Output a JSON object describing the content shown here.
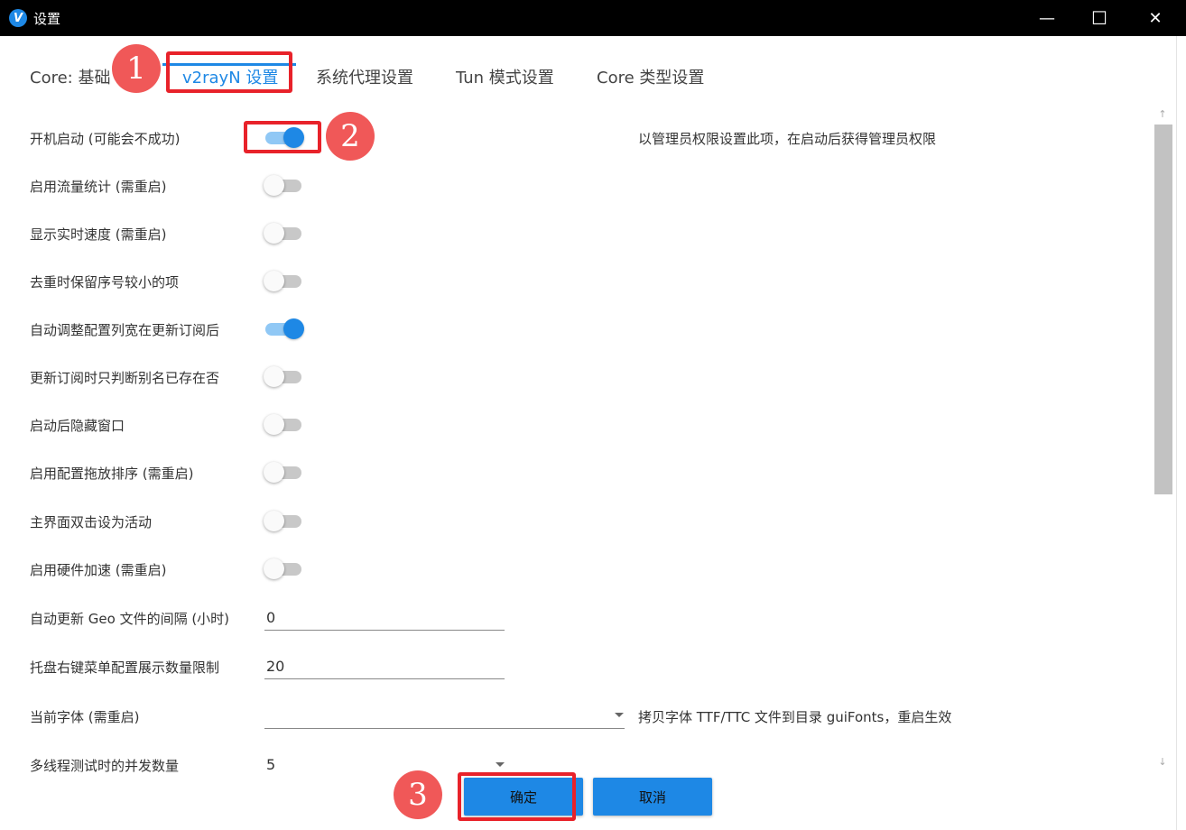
{
  "window": {
    "title": "设置",
    "icon_letter": "V",
    "controls": {
      "minimize": "—",
      "maximize": "☐",
      "close": "✕"
    }
  },
  "tabs": [
    {
      "label": "Core: 基础",
      "active": false
    },
    {
      "label": "v2rayN 设置",
      "active": true
    },
    {
      "label": "系统代理设置",
      "active": false
    },
    {
      "label": "Tun 模式设置",
      "active": false
    },
    {
      "label": "Core 类型设置",
      "active": false
    }
  ],
  "settings": {
    "toggles": [
      {
        "label": "开机启动 (可能会不成功)",
        "on": true
      },
      {
        "label": "启用流量统计 (需重启)",
        "on": false
      },
      {
        "label": "显示实时速度 (需重启)",
        "on": false
      },
      {
        "label": "去重时保留序号较小的项",
        "on": false
      },
      {
        "label": "自动调整配置列宽在更新订阅后",
        "on": true
      },
      {
        "label": "更新订阅时只判断别名已存在否",
        "on": false
      },
      {
        "label": "启动后隐藏窗口",
        "on": false
      },
      {
        "label": "启用配置拖放排序 (需重启)",
        "on": false
      },
      {
        "label": "主界面双击设为活动",
        "on": false
      },
      {
        "label": "启用硬件加速 (需重启)",
        "on": false
      }
    ],
    "autostart_hint": "以管理员权限设置此项，在启动后获得管理员权限",
    "geo_interval": {
      "label": "自动更新 Geo 文件的间隔 (小时)",
      "value": "0"
    },
    "tray_limit": {
      "label": "托盘右键菜单配置展示数量限制",
      "value": "20"
    },
    "font": {
      "label": "当前字体 (需重启)",
      "value": "",
      "hint": "拷贝字体 TTF/TTC 文件到目录 guiFonts，重启生效"
    },
    "concurrency": {
      "label": "多线程测试时的并发数量",
      "value": "5"
    }
  },
  "buttons": {
    "ok": "确定",
    "cancel": "取消"
  },
  "annotations": [
    "1",
    "2",
    "3"
  ],
  "colors": {
    "accent": "#1e88e5",
    "annotation": "#f05858",
    "highlight_box": "#e8222a"
  }
}
